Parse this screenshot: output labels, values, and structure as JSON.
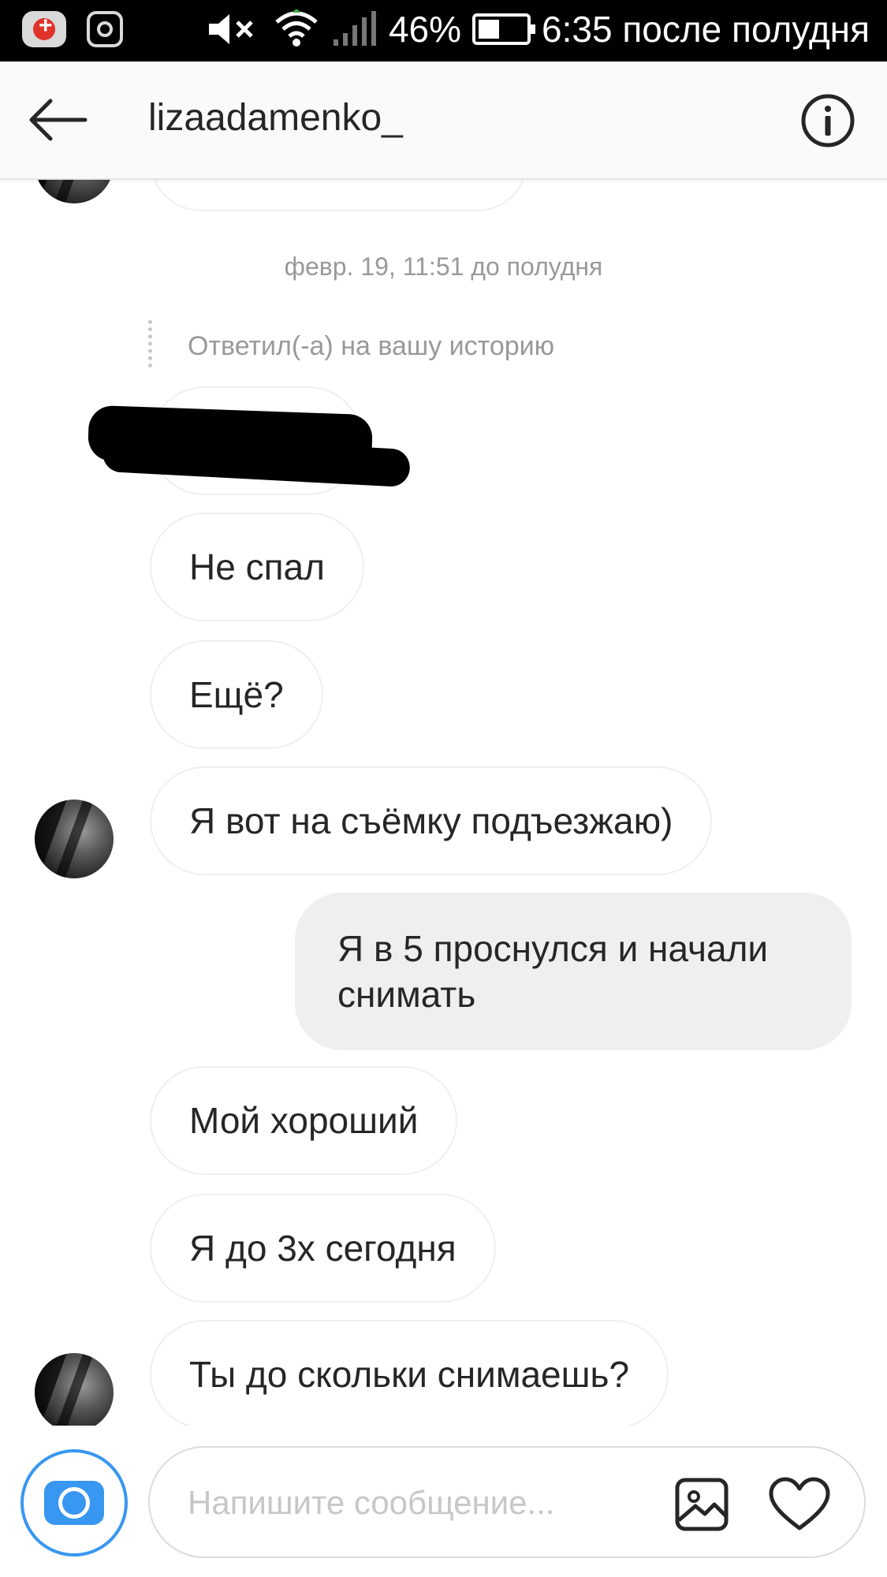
{
  "status_bar": {
    "battery": "46%",
    "time": "6:35 после полудня",
    "icons": [
      "app-notification-icon",
      "instagram-icon",
      "mute-icon",
      "wifi-icon",
      "signal-icon",
      "battery-icon"
    ]
  },
  "header": {
    "username": "lizaadamenko_",
    "back_icon": "arrow-left-icon",
    "info_icon": "info-icon"
  },
  "chat": {
    "timestamp": "февр. 19, 11:51 до полудня",
    "reply_note": "Ответил(-а) на вашу историю",
    "messages": [
      {
        "text": "Не спал",
        "sender": "them"
      },
      {
        "text": "Ещё?",
        "sender": "them"
      },
      {
        "text": "Я вот на съёмку подъезжаю)",
        "sender": "them"
      },
      {
        "text": "Я в 5 проснулся и начали снимать",
        "sender": "me"
      },
      {
        "text": "Мой хороший",
        "sender": "them"
      },
      {
        "text": "Я до 3х сегодня",
        "sender": "them"
      },
      {
        "text": "Ты до скольки снимаешь?",
        "sender": "them"
      }
    ]
  },
  "composer": {
    "placeholder": "Напишите сообщение...",
    "camera_icon": "camera-icon",
    "gallery_icon": "gallery-icon",
    "heart_icon": "heart-icon"
  },
  "colors": {
    "accent": "#3897f0",
    "my_bubble": "#efefef",
    "muted_text": "#999999"
  }
}
